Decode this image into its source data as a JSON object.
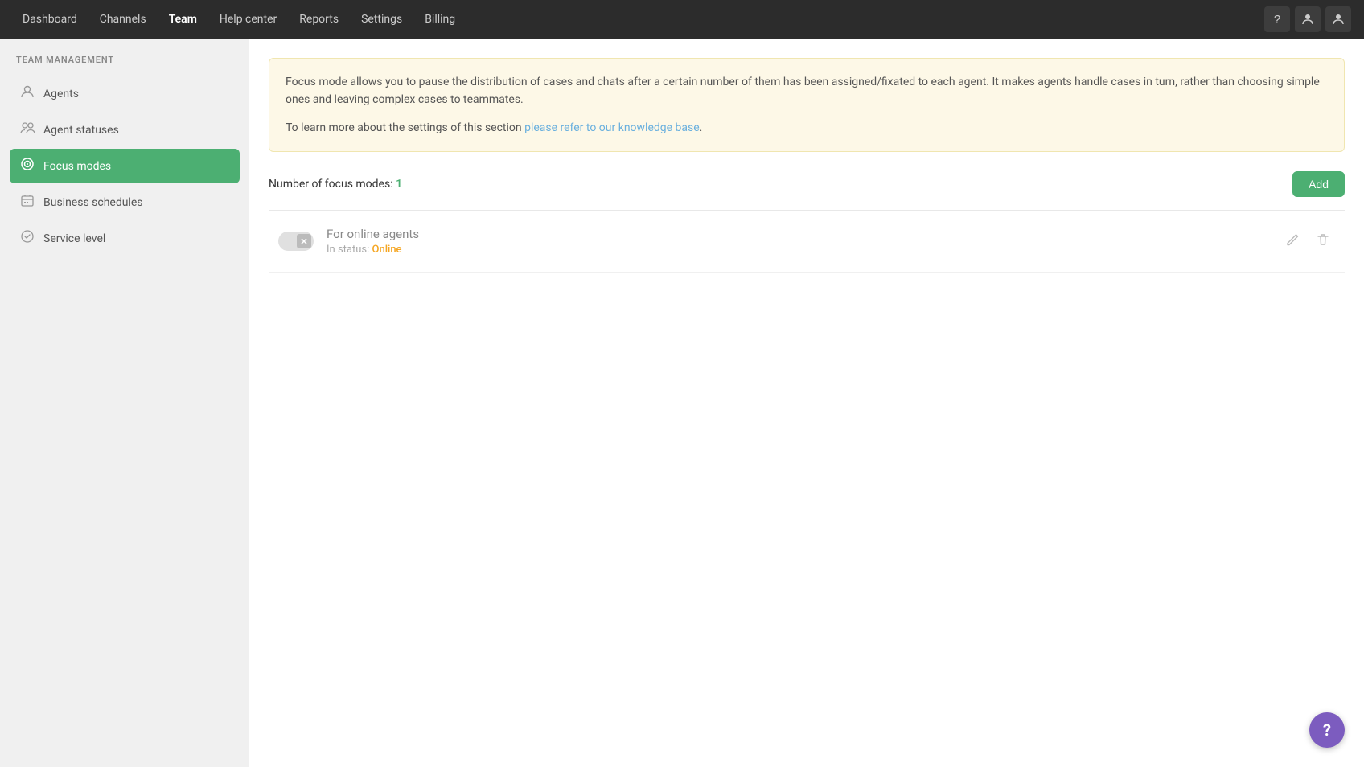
{
  "nav": {
    "links": [
      {
        "id": "dashboard",
        "label": "Dashboard",
        "active": false
      },
      {
        "id": "channels",
        "label": "Channels",
        "active": false
      },
      {
        "id": "team",
        "label": "Team",
        "active": true
      },
      {
        "id": "help-center",
        "label": "Help center",
        "active": false
      },
      {
        "id": "reports",
        "label": "Reports",
        "active": false
      },
      {
        "id": "settings",
        "label": "Settings",
        "active": false
      },
      {
        "id": "billing",
        "label": "Billing",
        "active": false
      }
    ],
    "icons": {
      "help": "?",
      "user": "👤",
      "dropdown": "▾"
    }
  },
  "sidebar": {
    "title": "TEAM MANAGEMENT",
    "items": [
      {
        "id": "agents",
        "label": "Agents",
        "icon": "👤",
        "active": false
      },
      {
        "id": "agent-statuses",
        "label": "Agent statuses",
        "icon": "👥",
        "active": false
      },
      {
        "id": "focus-modes",
        "label": "Focus modes",
        "icon": "🎯",
        "active": true
      },
      {
        "id": "business-schedules",
        "label": "Business schedules",
        "icon": "🗂",
        "active": false
      },
      {
        "id": "service-level",
        "label": "Service level",
        "icon": "⚙",
        "active": false
      }
    ]
  },
  "main": {
    "info_text_1": "Focus mode allows you to pause the distribution of cases and chats after a certain number of them has been assigned/fixated to each agent. It makes agents handle cases in turn, rather than choosing simple ones and leaving complex cases to teammates.",
    "info_text_2": "To learn more about the settings of this section ",
    "info_link_text": "please refer to our knowledge base",
    "info_text_end": ".",
    "section_label": "Number of focus modes:",
    "count": "1",
    "add_button": "Add",
    "focus_modes": [
      {
        "id": "for-online-agents",
        "name": "For online agents",
        "status_label": "In status:",
        "status_value": "Online"
      }
    ]
  },
  "help_fab": "?"
}
